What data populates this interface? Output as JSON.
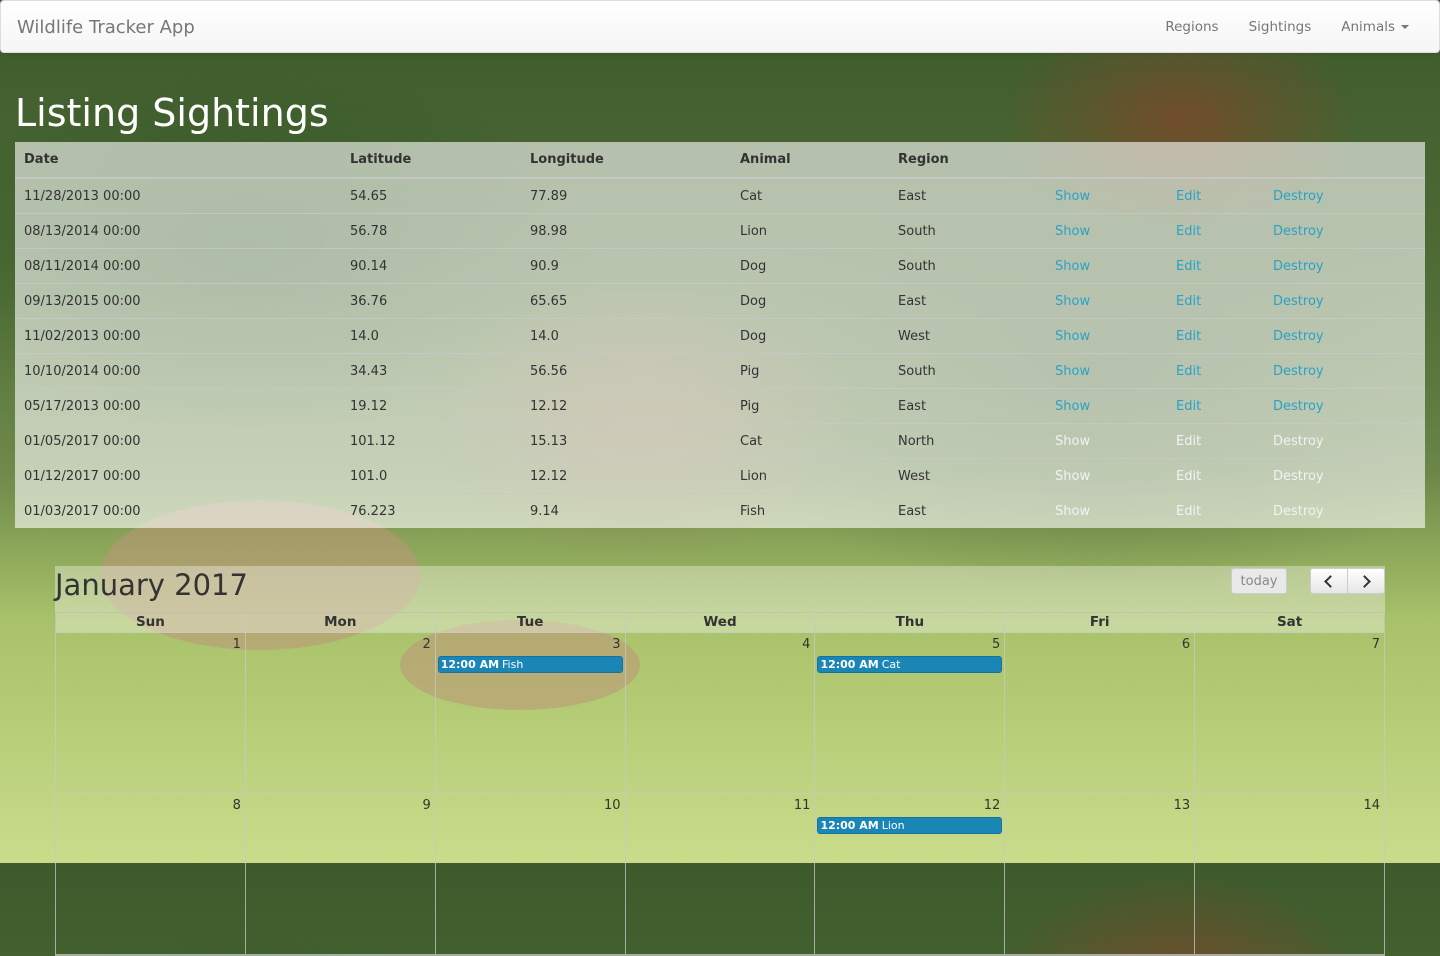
{
  "navbar": {
    "brand": "Wildlife Tracker App",
    "links": [
      "Regions",
      "Sightings",
      "Animals"
    ]
  },
  "page_title": "Listing Sightings",
  "table": {
    "headers": [
      "Date",
      "Latitude",
      "Longitude",
      "Animal",
      "Region"
    ],
    "actions": [
      "Show",
      "Edit",
      "Destroy"
    ],
    "rows": [
      [
        "11/28/2013 00:00",
        "54.65",
        "77.89",
        "Cat",
        "East"
      ],
      [
        "08/13/2014 00:00",
        "56.78",
        "98.98",
        "Lion",
        "South"
      ],
      [
        "08/11/2014 00:00",
        "90.14",
        "90.9",
        "Dog",
        "South"
      ],
      [
        "09/13/2015 00:00",
        "36.76",
        "65.65",
        "Dog",
        "East"
      ],
      [
        "11/02/2013 00:00",
        "14.0",
        "14.0",
        "Dog",
        "West"
      ],
      [
        "10/10/2014 00:00",
        "34.43",
        "56.56",
        "Pig",
        "South"
      ],
      [
        "05/17/2013 00:00",
        "19.12",
        "12.12",
        "Pig",
        "East"
      ],
      [
        "01/05/2017 00:00",
        "101.12",
        "15.13",
        "Cat",
        "North"
      ],
      [
        "01/12/2017 00:00",
        "101.0",
        "12.12",
        "Lion",
        "West"
      ],
      [
        "01/03/2017 00:00",
        "76.223",
        "9.14",
        "Fish",
        "East"
      ]
    ]
  },
  "calendar": {
    "title": "January 2017",
    "today_label": "today",
    "weekdays": [
      "Sun",
      "Mon",
      "Tue",
      "Wed",
      "Thu",
      "Fri",
      "Sat"
    ],
    "weeks": [
      [
        "1",
        "2",
        "3",
        "4",
        "5",
        "6",
        "7"
      ],
      [
        "8",
        "9",
        "10",
        "11",
        "12",
        "13",
        "14"
      ]
    ],
    "events": [
      {
        "week": 0,
        "day": 2,
        "time": "12:00 AM",
        "title": "Fish"
      },
      {
        "week": 0,
        "day": 4,
        "time": "12:00 AM",
        "title": "Cat"
      },
      {
        "week": 1,
        "day": 4,
        "time": "12:00 AM",
        "title": "Lion"
      }
    ],
    "event_color": "#1a86b5"
  }
}
